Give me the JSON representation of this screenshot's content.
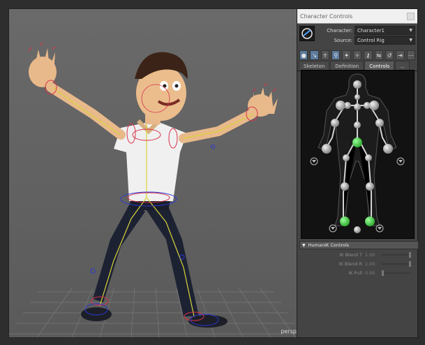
{
  "viewport": {
    "camera_label": "persp"
  },
  "panel": {
    "title": "Character Controls",
    "character_label": "Character:",
    "character_value": "Character1",
    "source_label": "Source:",
    "source_value": "Control Rig",
    "toolbar_icons": [
      "select-rig-icon",
      "edit-ik-icon",
      "full-body-icon",
      "body-part-icon",
      "pin-icon",
      "release-icon",
      "key-icon",
      "mirror-icon",
      "reset-icon",
      "stance-icon",
      "more-icon"
    ],
    "tabs": [
      {
        "label": "Skeleton",
        "active": false
      },
      {
        "label": "Definition",
        "active": false
      },
      {
        "label": "Controls",
        "active": true
      },
      {
        "label": "...",
        "active": false
      }
    ],
    "section_title": "HumanIK Controls",
    "sliders": [
      {
        "label": "IK Blend T",
        "value": "1.00",
        "level": 1.0
      },
      {
        "label": "IK Blend R",
        "value": "1.00",
        "level": 1.0
      },
      {
        "label": "IK Pull",
        "value": "0.00",
        "level": 0.0
      }
    ]
  },
  "colors": {
    "effector_selected": "#49d94a",
    "joint": "#b9b9b9",
    "rig_yellow": "#d9d43a",
    "rig_red": "#d8324a",
    "rig_blue": "#2d38d4"
  }
}
